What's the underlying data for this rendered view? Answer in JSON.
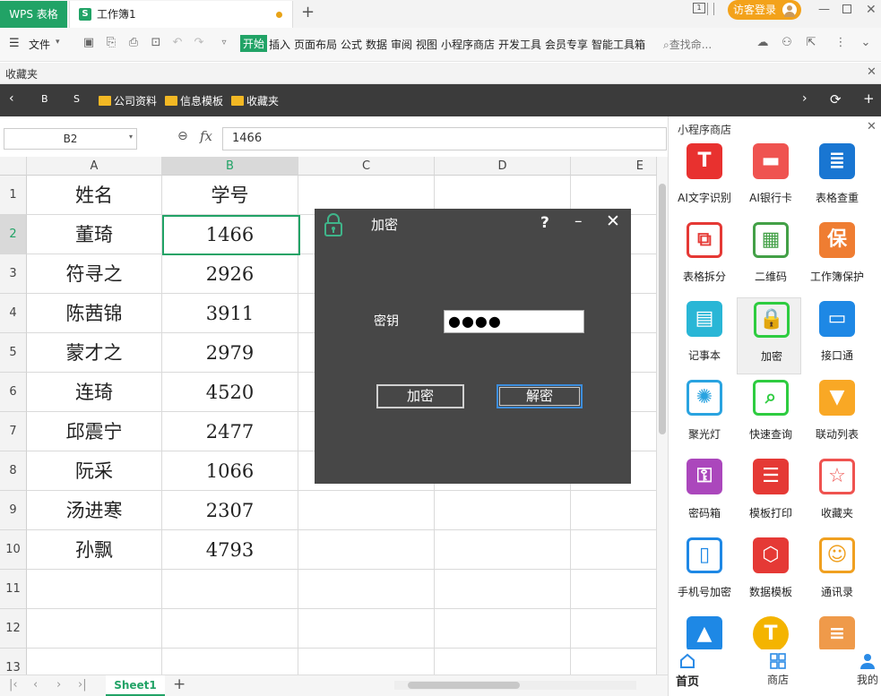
{
  "titlebar": {
    "app_tab": "WPS 表格",
    "doc_tab": "工作簿1",
    "new_tab": "+",
    "login": "访客登录",
    "window_controls": [
      "minimize",
      "maximize",
      "close"
    ]
  },
  "menu": {
    "file": "文件",
    "items": [
      "开始",
      "插入",
      "页面布局",
      "公式",
      "数据",
      "审阅",
      "视图",
      "小程序商店",
      "开发工具",
      "会员专享",
      "智能工具箱"
    ],
    "active": "开始",
    "search": "查找命..."
  },
  "favorites": {
    "title": "收藏夹",
    "items": [
      "B",
      "S",
      "公司资料",
      "信息模板",
      "收藏夹"
    ]
  },
  "formula_bar": {
    "cell_ref": "B2",
    "fx": "fx",
    "value": "1466"
  },
  "sheet": {
    "columns": [
      "A",
      "B",
      "C",
      "D",
      "E"
    ],
    "row_numbers": [
      "1",
      "2",
      "3",
      "4",
      "5",
      "6",
      "7",
      "8",
      "9",
      "10",
      "11",
      "12",
      "13"
    ],
    "rows": [
      [
        "姓名",
        "学号"
      ],
      [
        "董琦",
        "1466"
      ],
      [
        "符寻之",
        "2926"
      ],
      [
        "陈茜锦",
        "3911"
      ],
      [
        "蒙才之",
        "2979"
      ],
      [
        "连琦",
        "4520"
      ],
      [
        "邱震宁",
        "2477"
      ],
      [
        "阮采",
        "1066"
      ],
      [
        "汤进寒",
        "2307"
      ],
      [
        "孙飘",
        "4793"
      ]
    ],
    "selected": "B2",
    "tabs": [
      "Sheet1"
    ],
    "add_sheet": "+"
  },
  "dialog": {
    "title": "加密",
    "help": "?",
    "minimize": "–",
    "close": "✕",
    "key_label": "密钥",
    "key_value": "●●●●",
    "encrypt_button": "加密",
    "decrypt_button": "解密"
  },
  "mini_store": {
    "title": "小程序商店",
    "apps": [
      {
        "label": "AI文字识别",
        "icon": "text-recognition-icon",
        "color": "#e8312f"
      },
      {
        "label": "AI银行卡",
        "icon": "bank-card-icon",
        "color": "#ef5350"
      },
      {
        "label": "表格查重",
        "icon": "table-dedup-icon",
        "color": "#1976d2"
      },
      {
        "label": "表格拆分",
        "icon": "table-split-icon",
        "color": "#e53935"
      },
      {
        "label": "二维码",
        "icon": "qrcode-icon",
        "color": "#43a047"
      },
      {
        "label": "工作簿保护",
        "icon": "workbook-protect-icon",
        "color": "#ef7d32"
      },
      {
        "label": "记事本",
        "icon": "notepad-icon",
        "color": "#29b6d6"
      },
      {
        "label": "加密",
        "icon": "lock-icon",
        "color": "#2ecc40"
      },
      {
        "label": "接口通",
        "icon": "monitor-icon",
        "color": "#1e88e5"
      },
      {
        "label": "聚光灯",
        "icon": "lightbulb-icon",
        "color": "#29a3e0"
      },
      {
        "label": "快速查询",
        "icon": "search-icon",
        "color": "#2ecc40"
      },
      {
        "label": "联动列表",
        "icon": "dropdown-list-icon",
        "color": "#f9a825"
      },
      {
        "label": "密码箱",
        "icon": "password-box-icon",
        "color": "#ab47bc"
      },
      {
        "label": "模板打印",
        "icon": "print-template-icon",
        "color": "#e53935"
      },
      {
        "label": "收藏夹",
        "icon": "favorites-icon",
        "color": "#ef5350"
      },
      {
        "label": "手机号加密",
        "icon": "phone-icon",
        "color": "#1e88e5"
      },
      {
        "label": "数据模板",
        "icon": "data-template-icon",
        "color": "#e53935"
      },
      {
        "label": "通讯录",
        "icon": "contacts-icon",
        "color": "#f0a020"
      },
      {
        "label": "",
        "icon": "image-icon",
        "color": "#1e88e5"
      },
      {
        "label": "",
        "icon": "t-circle-icon",
        "color": "#f4b400"
      },
      {
        "label": "",
        "icon": "document-icon",
        "color": "#ef9a4a"
      }
    ],
    "selected": "加密",
    "nav": [
      "首页",
      "商店",
      "我的"
    ]
  },
  "colors": {
    "accent": "#21a366",
    "dialog_bg": "#474747",
    "favbar_bg": "#3b3b3b"
  }
}
